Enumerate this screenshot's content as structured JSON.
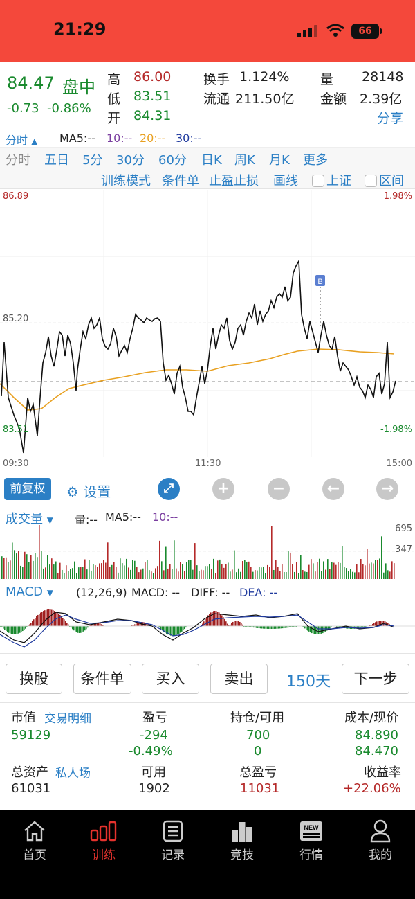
{
  "status_bar": {
    "time": "21:29",
    "battery": "66"
  },
  "quote": {
    "price": "84.47",
    "status": "盘中",
    "change": "-0.73",
    "change_pct": "-0.86%",
    "high_label": "高",
    "high": "86.00",
    "low_label": "低",
    "low": "83.51",
    "open_label": "开",
    "open": "84.31",
    "turnover_label": "换手",
    "turnover": "1.124%",
    "float_label": "流通",
    "float": "211.50亿",
    "volume_label": "量",
    "volume": "28148",
    "amount_label": "金额",
    "amount": "2.39亿",
    "share": "分享"
  },
  "ma_row": {
    "label": "分时",
    "ma5": "MA5:--",
    "ma10": "10:--",
    "ma20": "20:--",
    "ma30": "30:--"
  },
  "periods": [
    "分时",
    "五日",
    "5分",
    "30分",
    "60分",
    "日K",
    "周K",
    "月K",
    "更多"
  ],
  "tools": {
    "training": "训练模式",
    "condition": "条件单",
    "stop": "止盈止损",
    "draw": "画线",
    "index": "上证",
    "range": "区间"
  },
  "chart": {
    "y_top": "86.89",
    "y_mid": "85.20",
    "y_bottom": "83.51",
    "pct_top": "1.98%",
    "pct_bottom": "-1.98%",
    "x_start": "09:30",
    "x_mid": "11:30",
    "x_end": "15:00",
    "marker": "B"
  },
  "buttons": {
    "restore": "前复权",
    "settings": "设置"
  },
  "volume_panel": {
    "label": "成交量",
    "vol": "量:--",
    "ma5": "MA5:--",
    "ma10": "10:--",
    "axis_top": "695",
    "axis_mid": "347"
  },
  "macd_panel": {
    "label": "MACD",
    "params": "(12,26,9)",
    "macd": "MACD: --",
    "diff": "DIFF: --",
    "dea": "DEA: --"
  },
  "actions": {
    "switch": "换股",
    "condition": "条件单",
    "buy": "买入",
    "sell": "卖出",
    "days": "150天",
    "next": "下一步"
  },
  "account": {
    "headers": {
      "market_value": "市值",
      "trade_detail": "交易明细",
      "pnl": "盈亏",
      "position": "持仓/可用",
      "cost": "成本/现价"
    },
    "row1": {
      "market_value": "59129",
      "pnl": "-294",
      "pnl_pct": "-0.49%",
      "position": "700",
      "available": "0",
      "cost": "84.890",
      "price": "84.470"
    },
    "headers2": {
      "total_assets": "总资产",
      "private": "私人场",
      "usable": "可用",
      "total_pnl": "总盈亏",
      "yield": "收益率"
    },
    "row2": {
      "total_assets": "61031",
      "usable": "1902",
      "total_pnl": "11031",
      "yield": "+22.06%"
    }
  },
  "tabs": [
    {
      "label": "首页",
      "icon": "home-icon"
    },
    {
      "label": "训练",
      "icon": "bar-chart-icon"
    },
    {
      "label": "记录",
      "icon": "list-icon"
    },
    {
      "label": "竞技",
      "icon": "podium-icon"
    },
    {
      "label": "行情",
      "icon": "news-icon"
    },
    {
      "label": "我的",
      "icon": "user-icon"
    }
  ],
  "colors": {
    "up": "#b52a2a",
    "down": "#1a8a2e",
    "accent": "#2b7fc5",
    "avg_line": "#e8a020",
    "status_bar": "#f4483b"
  }
}
